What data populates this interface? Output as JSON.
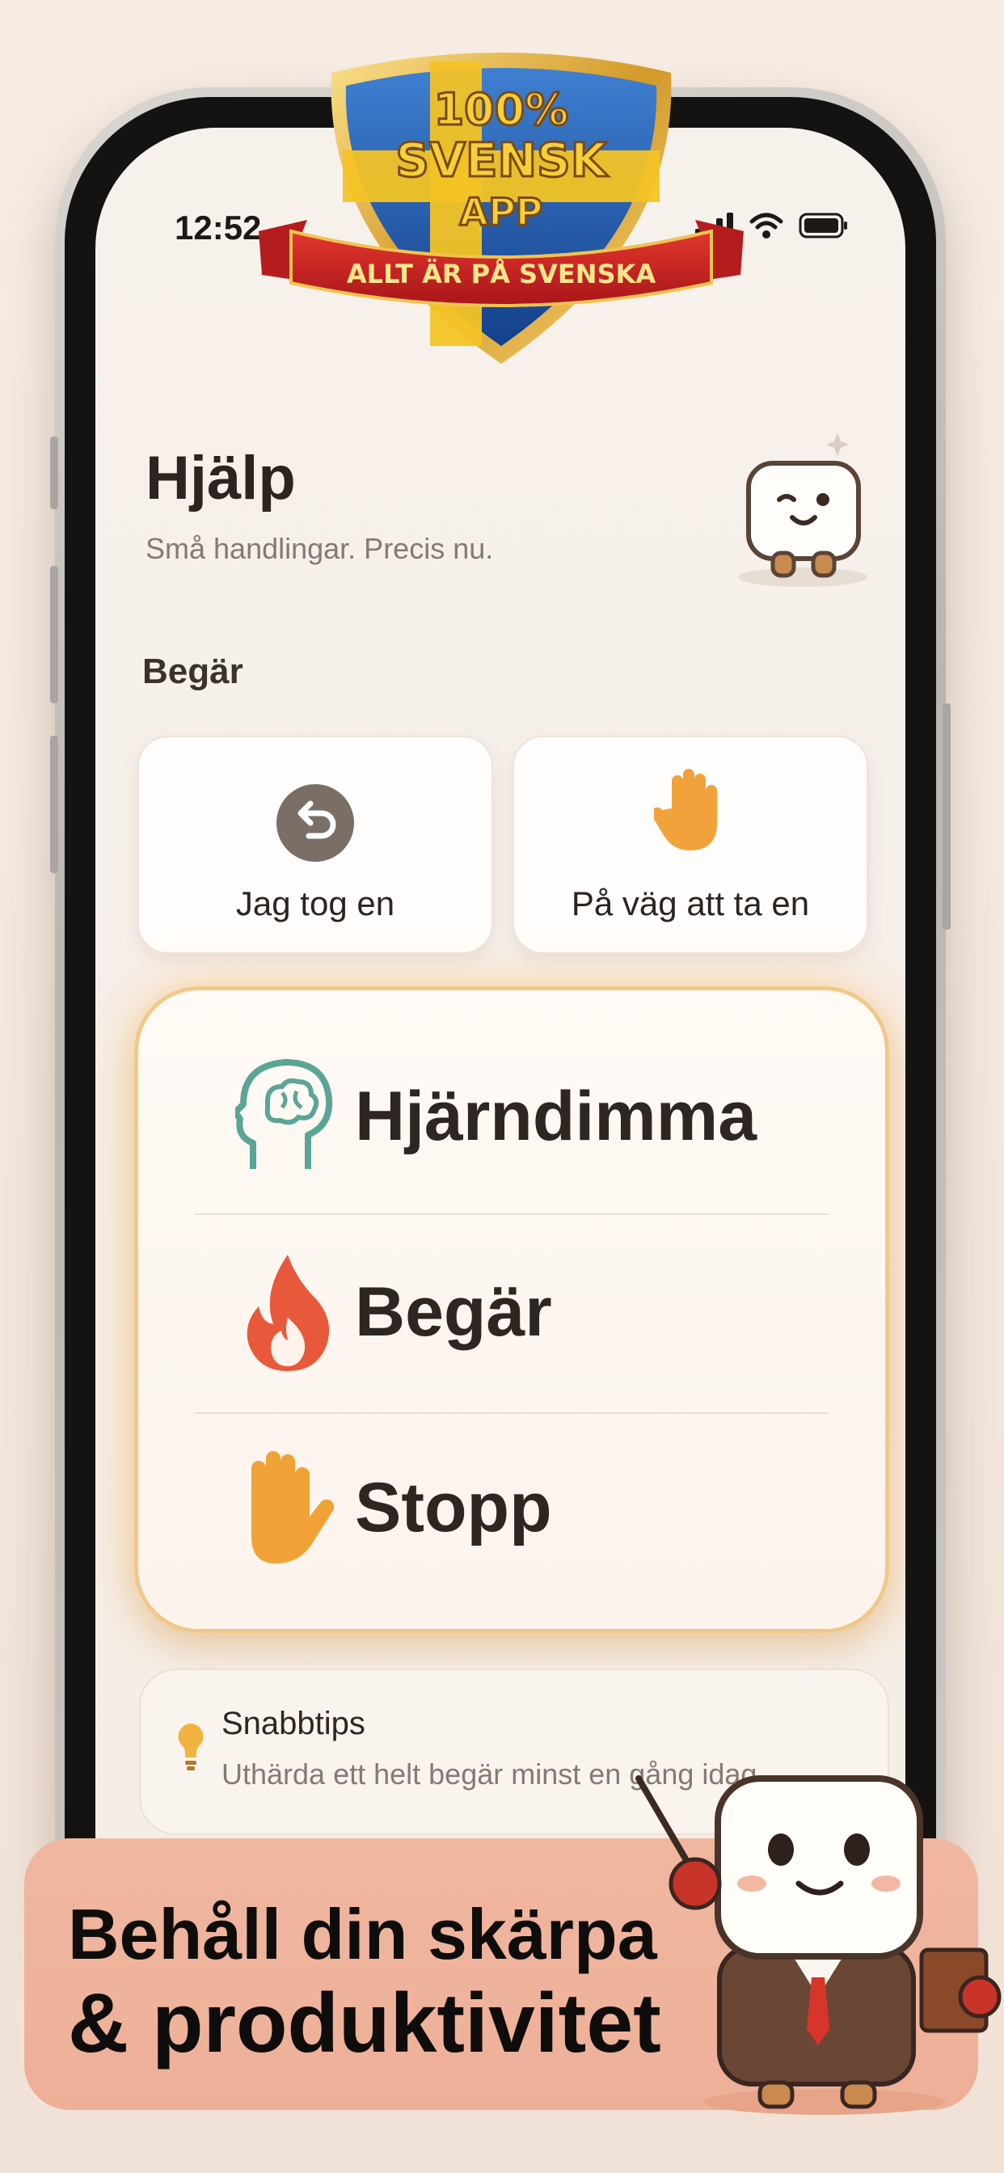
{
  "status_bar": {
    "time": "12:52"
  },
  "badge": {
    "line1": "100%",
    "line2": "SVENSK",
    "line3": "APP",
    "ribbon": "ALLT ÄR PÅ SVENSKA"
  },
  "header": {
    "title": "Hjälp",
    "subtitle": "Små handlingar. Precis nu."
  },
  "section": {
    "label": "Begär"
  },
  "quick_actions": [
    {
      "label": "Jag tog en",
      "icon": "undo-icon"
    },
    {
      "label": "På väg att ta en",
      "icon": "raised-hand-icon"
    }
  ],
  "menu": [
    {
      "label": "Hjärndimma",
      "icon": "brain-icon"
    },
    {
      "label": "Begär",
      "icon": "flame-icon"
    },
    {
      "label": "Stopp",
      "icon": "stop-hand-icon"
    }
  ],
  "tip": {
    "title": "Snabbtips",
    "text": "Uthärda ett helt begär minst en gång idag.",
    "icon": "lightbulb-icon"
  },
  "banner": {
    "line1": "Behåll din skärpa",
    "line2": "& produktivitet"
  },
  "colors": {
    "accent_orange": "#f2a23a",
    "brain_green": "#5aa596",
    "flame_red": "#e8583a",
    "banner_bg": "#f0b7a0",
    "panel_glow": "#f0c98a"
  }
}
